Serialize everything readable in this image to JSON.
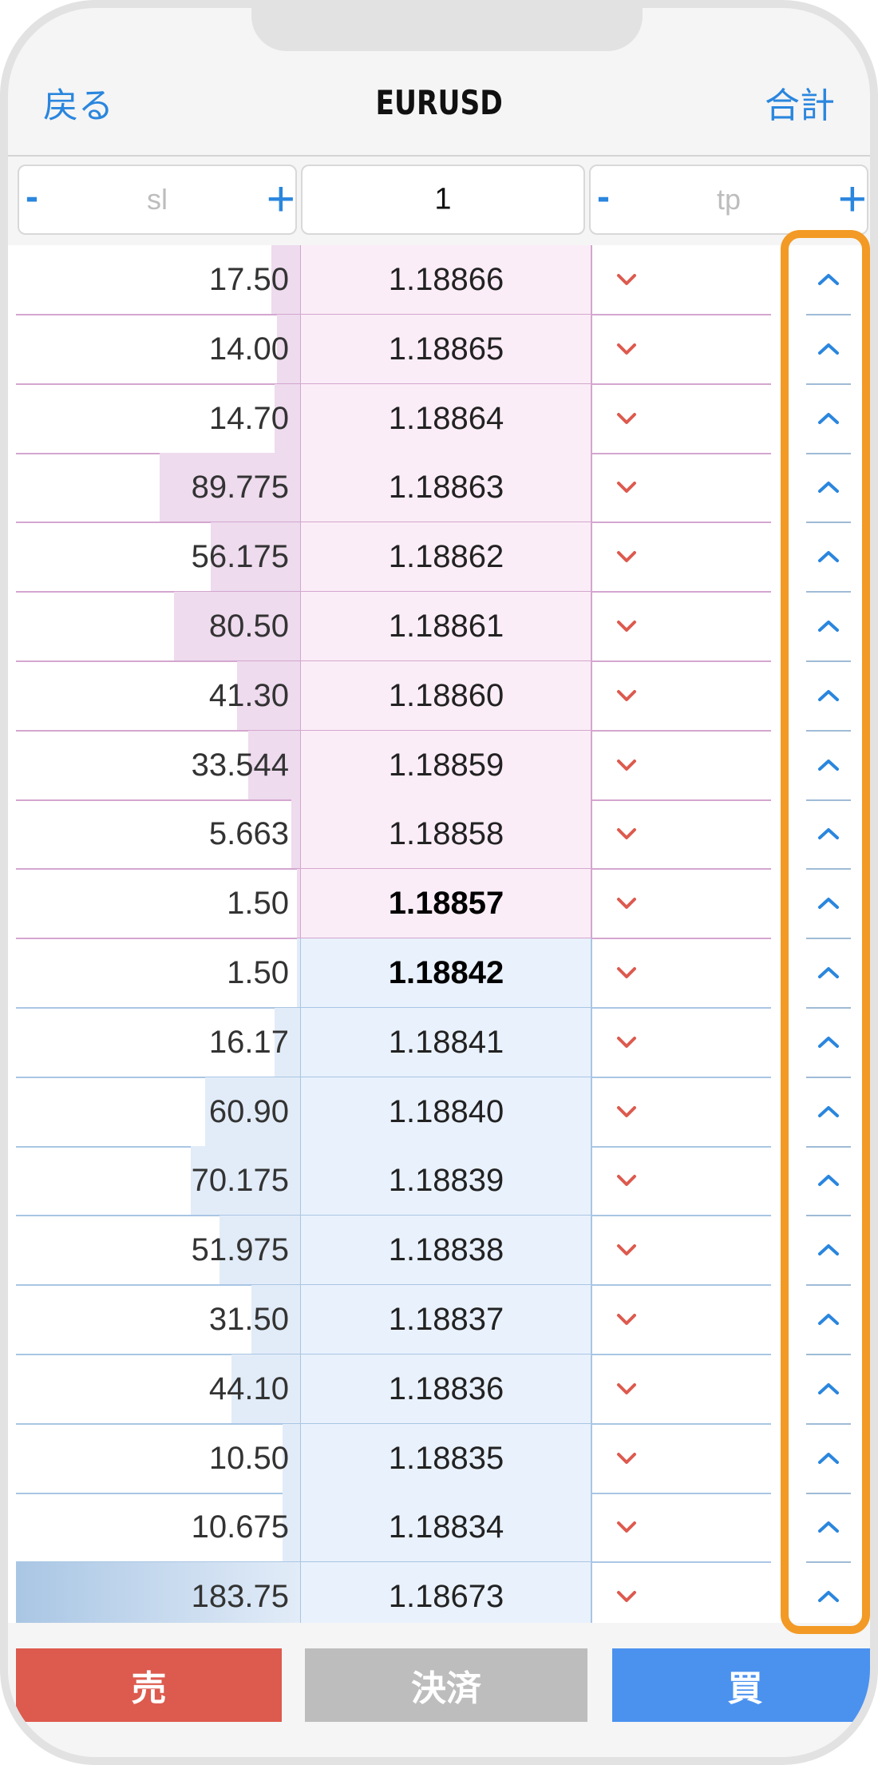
{
  "nav": {
    "back_label": "戻る",
    "title": "EURUSD",
    "total_label": "合計"
  },
  "inputs": {
    "sl": {
      "placeholder": "sl",
      "minus": "-",
      "plus": "+"
    },
    "lot": {
      "value": "1"
    },
    "tp": {
      "placeholder": "tp",
      "minus": "-",
      "plus": "+"
    }
  },
  "colors": {
    "accent": "#2a86de",
    "sell": "#dd5a4e",
    "buy": "#4b92ef",
    "settle": "#bdbdbd",
    "highlight": "#f29a25",
    "down_arrow": "#dd5a4e",
    "up_arrow": "#2a86de"
  },
  "icons": {
    "down": "chevron-down-icon",
    "up": "chevron-up-icon"
  },
  "orderbook": {
    "rows": [
      {
        "side": "ask",
        "volume": "17.50",
        "price": "1.18866",
        "bar_fraction": 0.1
      },
      {
        "side": "ask",
        "volume": "14.00",
        "price": "1.18865",
        "bar_fraction": 0.08
      },
      {
        "side": "ask",
        "volume": "14.70",
        "price": "1.18864",
        "bar_fraction": 0.09
      },
      {
        "side": "ask",
        "volume": "89.775",
        "price": "1.18863",
        "bar_fraction": 0.49
      },
      {
        "side": "ask",
        "volume": "56.175",
        "price": "1.18862",
        "bar_fraction": 0.31
      },
      {
        "side": "ask",
        "volume": "80.50",
        "price": "1.18861",
        "bar_fraction": 0.44
      },
      {
        "side": "ask",
        "volume": "41.30",
        "price": "1.18860",
        "bar_fraction": 0.22
      },
      {
        "side": "ask",
        "volume": "33.544",
        "price": "1.18859",
        "bar_fraction": 0.18
      },
      {
        "side": "ask",
        "volume": "5.663",
        "price": "1.18858",
        "bar_fraction": 0.03
      },
      {
        "side": "ask",
        "volume": "1.50",
        "price": "1.18857",
        "bar_fraction": 0.01,
        "best": true
      },
      {
        "side": "bid",
        "volume": "1.50",
        "price": "1.18842",
        "bar_fraction": 0.01,
        "best": true
      },
      {
        "side": "bid",
        "volume": "16.17",
        "price": "1.18841",
        "bar_fraction": 0.09
      },
      {
        "side": "bid",
        "volume": "60.90",
        "price": "1.18840",
        "bar_fraction": 0.33
      },
      {
        "side": "bid",
        "volume": "70.175",
        "price": "1.18839",
        "bar_fraction": 0.38
      },
      {
        "side": "bid",
        "volume": "51.975",
        "price": "1.18838",
        "bar_fraction": 0.28
      },
      {
        "side": "bid",
        "volume": "31.50",
        "price": "1.18837",
        "bar_fraction": 0.17
      },
      {
        "side": "bid",
        "volume": "44.10",
        "price": "1.18836",
        "bar_fraction": 0.24
      },
      {
        "side": "bid",
        "volume": "10.50",
        "price": "1.18835",
        "bar_fraction": 0.06
      },
      {
        "side": "bid",
        "volume": "10.675",
        "price": "1.18834",
        "bar_fraction": 0.06
      },
      {
        "side": "bid",
        "volume": "183.75",
        "price": "1.18673",
        "bar_fraction": 1.0
      }
    ]
  },
  "actions": {
    "sell_label": "売",
    "settle_label": "決済",
    "buy_label": "買"
  }
}
